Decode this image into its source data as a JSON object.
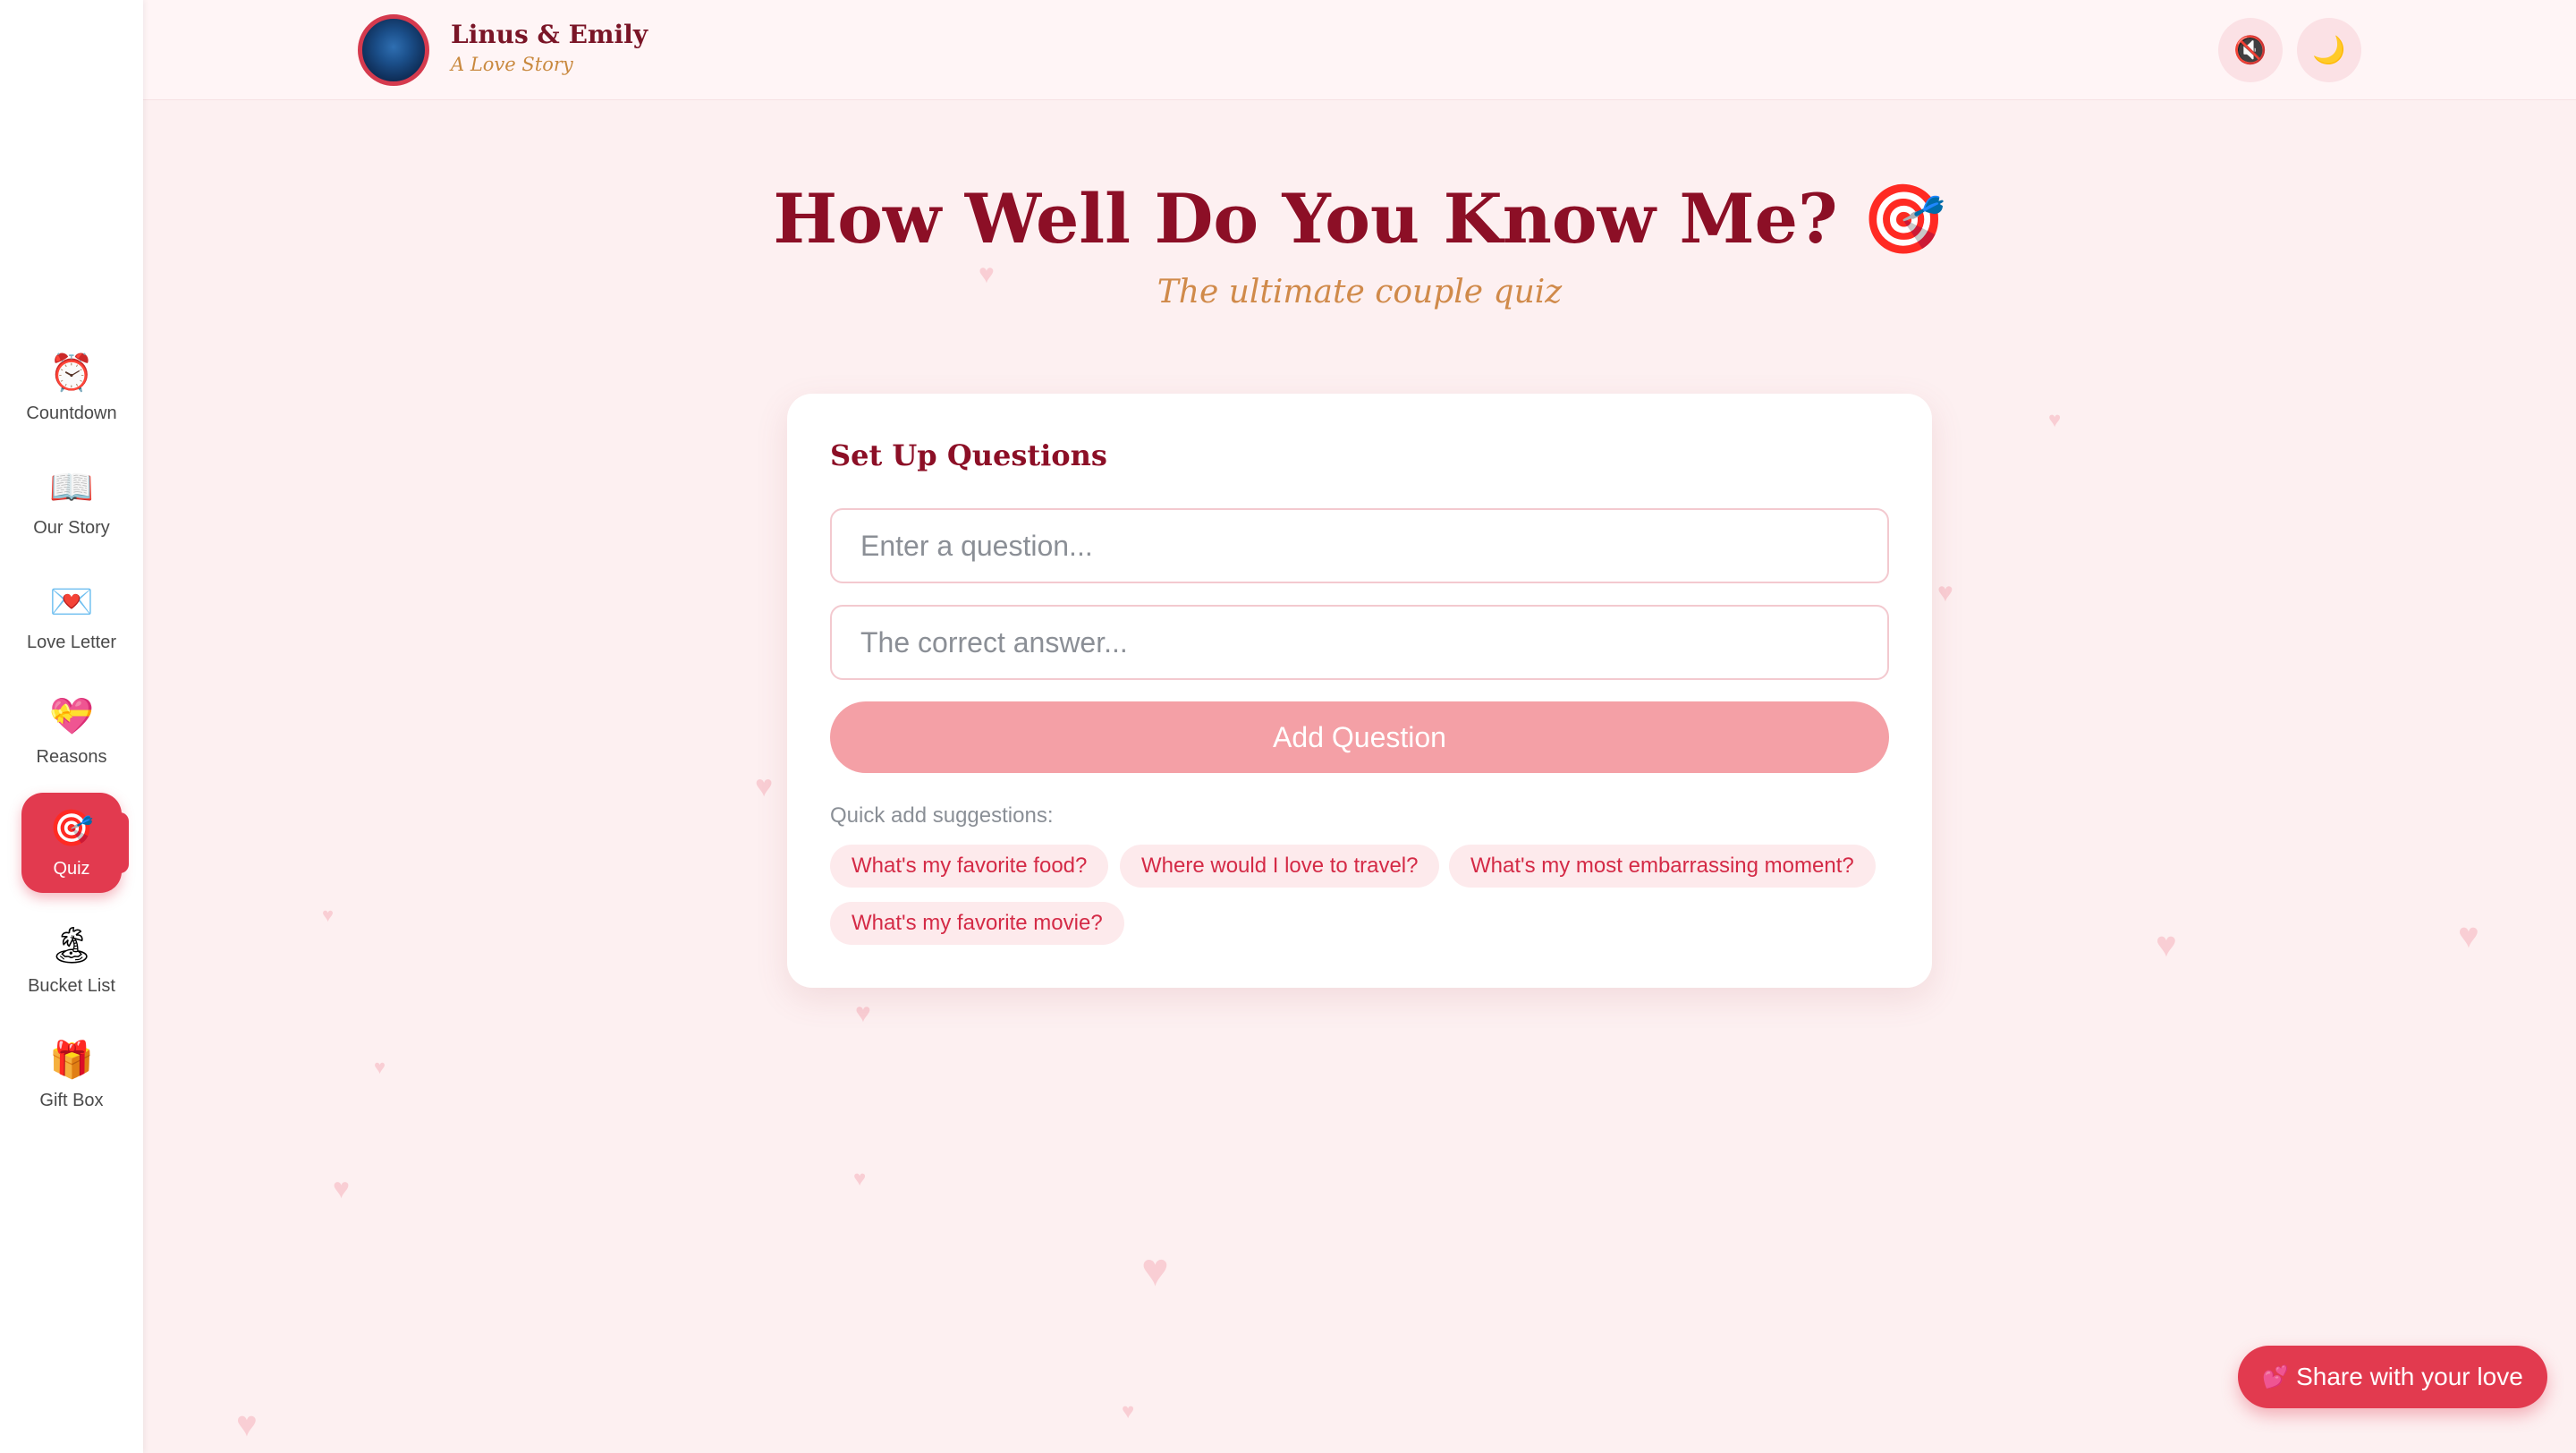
{
  "sidebar": {
    "items": [
      {
        "icon": "⏰",
        "label": "Countdown"
      },
      {
        "icon": "📖",
        "label": "Our Story"
      },
      {
        "icon": "💌",
        "label": "Love Letter"
      },
      {
        "icon": "💝",
        "label": "Reasons"
      },
      {
        "icon": "🎯",
        "label": "Quiz",
        "active": true
      },
      {
        "icon": "🏝",
        "label": "Bucket List"
      },
      {
        "icon": "🎁",
        "label": "Gift Box"
      }
    ]
  },
  "header": {
    "brand_name": "Linus & Emily",
    "brand_tagline": "A Love Story",
    "mute_icon": "🔇",
    "theme_icon": "🌙"
  },
  "main": {
    "title": "How Well Do You Know Me? 🎯",
    "subtitle": "The ultimate couple quiz"
  },
  "setup": {
    "heading": "Set Up Questions",
    "question_placeholder": "Enter a question...",
    "answer_placeholder": "The correct answer...",
    "add_button_label": "Add Question",
    "suggestions_label": "Quick add suggestions:",
    "suggestions": [
      "What's my favorite food?",
      "Where would I love to travel?",
      "What's my most embarrassing moment?",
      "What's my favorite movie?"
    ]
  },
  "share": {
    "icon": "💕",
    "label": "Share with your love"
  },
  "colors": {
    "accent": "#e23a4f",
    "title": "#8c0f26",
    "subtitle": "#d08a4a",
    "add_button": "#f4a0a6",
    "background": "#fdf0f1"
  }
}
